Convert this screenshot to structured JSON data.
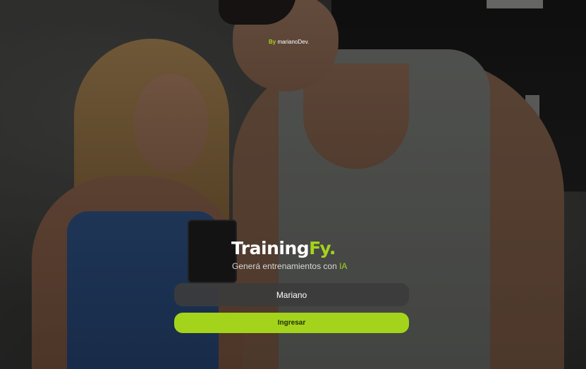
{
  "credit": {
    "prefix": "By",
    "author": "marianoDev."
  },
  "brand": {
    "name_main": "Training",
    "name_accent": "Fy."
  },
  "tagline": {
    "text": "Generá entrenamientos con ",
    "accent": "IA"
  },
  "login": {
    "name_value": "Mariano",
    "submit_label": "Ingresar"
  },
  "colors": {
    "accent": "#a4d31c",
    "field_bg": "#3c3c3c",
    "text": "#ffffff"
  }
}
